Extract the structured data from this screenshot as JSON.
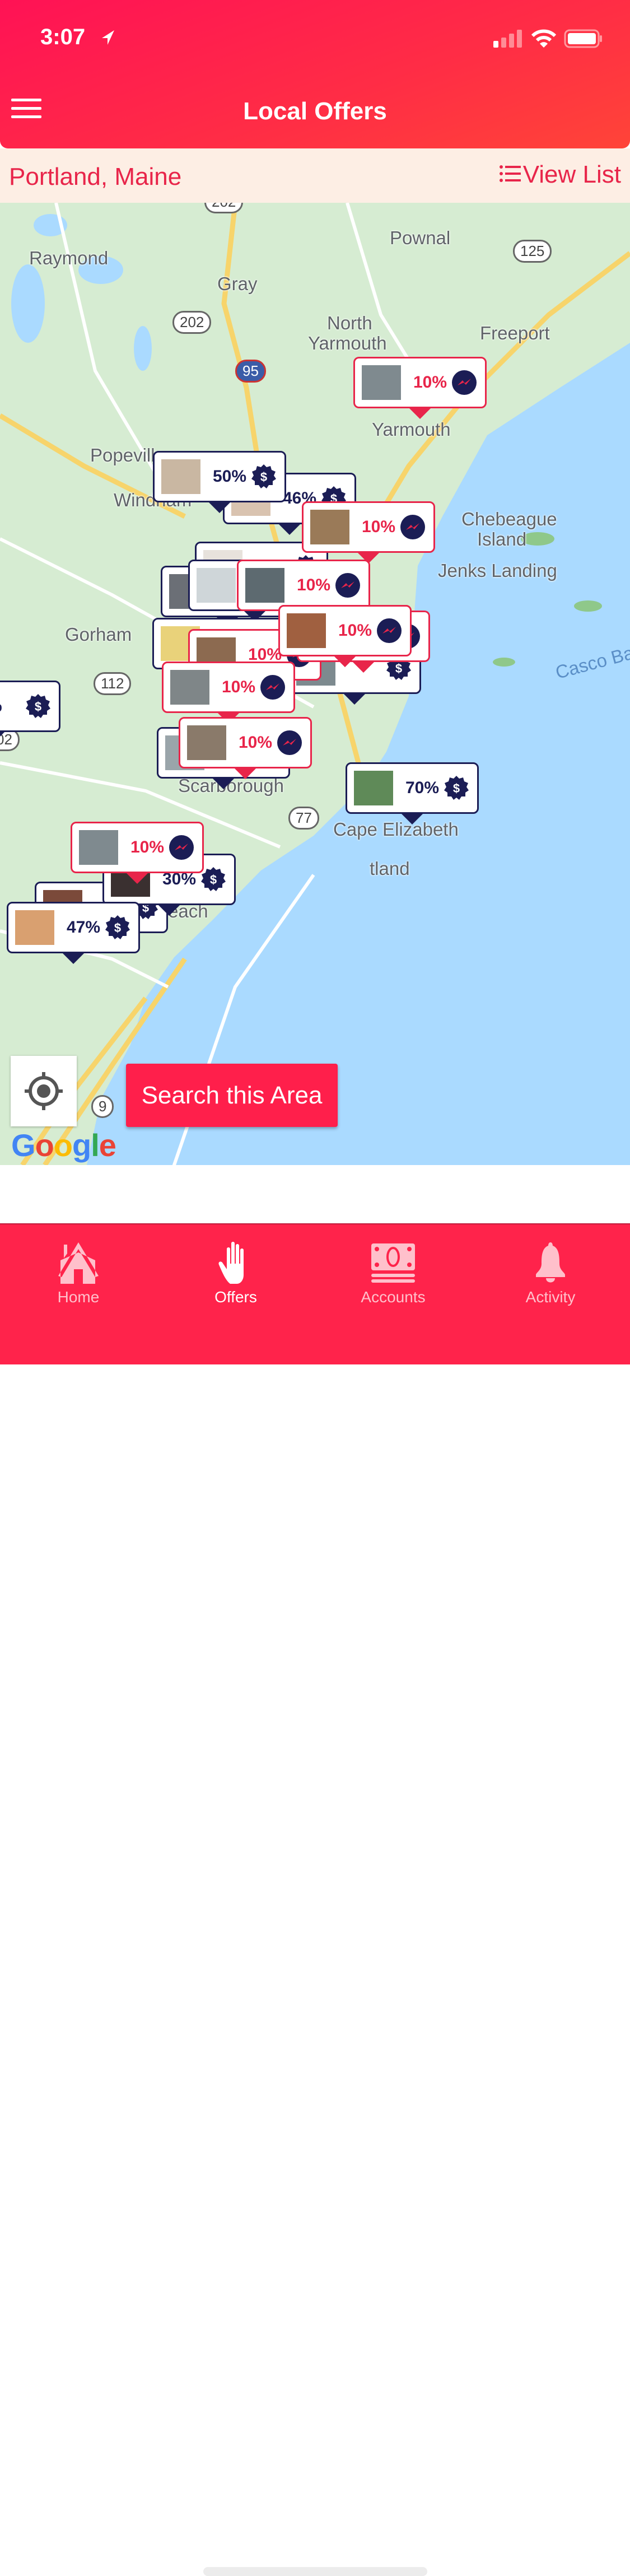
{
  "status_bar": {
    "time": "3:07"
  },
  "header": {
    "title": "Local Offers",
    "menu_icon": "hamburger-icon"
  },
  "location_bar": {
    "city": "Portland, Maine",
    "view_list_label": "View List",
    "view_list_icon": "list-icon"
  },
  "map": {
    "labels": [
      "Raymond",
      "Gray",
      "Pownal",
      "North",
      "Yarmouth",
      "Freeport",
      "Yarmouth",
      "Popeville",
      "Windham",
      "Chebeague",
      "Island",
      "Jenks Landing",
      "Gorham",
      "Casco Bay",
      "Scarborough",
      "Cape Elizabeth",
      "tland",
      "each",
      "9"
    ],
    "route_shields": [
      "202",
      "202",
      "95",
      "125",
      "112",
      "77",
      "9",
      "02"
    ],
    "markers": [
      {
        "percent": "46%",
        "type": "cashback",
        "thumb": "#d9c3b0"
      },
      {
        "percent": "",
        "type": "cashback",
        "thumb": "#e7e2dc"
      },
      {
        "percent": "",
        "type": "cashback",
        "thumb": "#6b6f76"
      },
      {
        "percent": "",
        "type": "cashback",
        "thumb": "#cfd6d9"
      },
      {
        "percent": "",
        "type": "cashback",
        "thumb": "#e9d27a"
      },
      {
        "percent": "",
        "type": "cashback",
        "thumb": "#9aa5aa"
      },
      {
        "percent": "",
        "type": "cashback",
        "thumb": "#7d8a8f"
      },
      {
        "percent": "%",
        "type": "cashback",
        "thumb": "#ffffff"
      },
      {
        "percent": "",
        "type": "cashback",
        "thumb": "#7b4a3a"
      },
      {
        "percent": "30%",
        "type": "cashback",
        "thumb": "#3a3030"
      },
      {
        "percent": "10%",
        "type": "boost",
        "thumb": "#5d6a70"
      },
      {
        "percent": "10%",
        "type": "boost",
        "thumb": "#8c6a50"
      },
      {
        "percent": "10%",
        "type": "boost",
        "thumb": "#8d9a99"
      },
      {
        "percent": "10%",
        "type": "boost",
        "thumb": "#8a9aa0"
      },
      {
        "percent": "10%",
        "type": "boost",
        "thumb": "#a06040"
      },
      {
        "percent": "50%",
        "type": "cashback",
        "thumb": "#c9b7a2"
      },
      {
        "percent": "10%",
        "type": "boost",
        "thumb": "#9a7a58"
      },
      {
        "percent": "10%",
        "type": "boost",
        "thumb": "#7f8688"
      },
      {
        "percent": "10%",
        "type": "boost",
        "thumb": "#8a7a6a"
      },
      {
        "percent": "70%",
        "type": "cashback",
        "thumb": "#5f8a58"
      },
      {
        "percent": "10%",
        "type": "boost",
        "thumb": "#7f8a8f"
      },
      {
        "percent": "47%",
        "type": "cashback",
        "thumb": "#d9a070"
      },
      {
        "percent": "10%",
        "type": "boost",
        "thumb": "#7f8a8f"
      }
    ],
    "locate_icon": "crosshair-icon",
    "search_area_label": "Search this Area",
    "attribution": "Google"
  },
  "tabs": [
    {
      "label": "Home",
      "icon": "home-icon",
      "active": false
    },
    {
      "label": "Offers",
      "icon": "hand-icon",
      "active": true
    },
    {
      "label": "Accounts",
      "icon": "cash-icon",
      "active": false
    },
    {
      "label": "Activity",
      "icon": "bell-icon",
      "active": false
    }
  ],
  "colors": {
    "brand": "#ff234b",
    "navy": "#1b1d55",
    "location_bar_bg": "#fdeee4",
    "water": "#aadaff",
    "land": "#d6ecd2"
  }
}
